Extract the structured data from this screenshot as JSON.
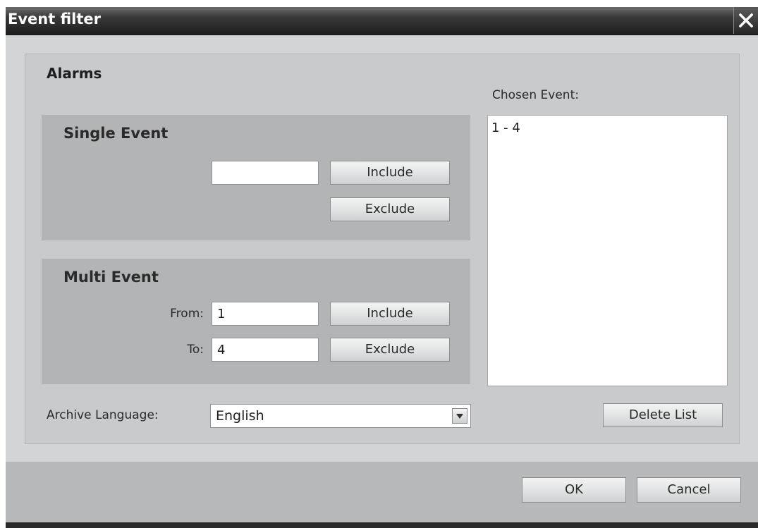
{
  "window": {
    "title": "Event filter"
  },
  "alarms": {
    "title": "Alarms",
    "chosen_label": "Chosen Event:",
    "chosen_items": [
      "1 - 4"
    ],
    "delete_label": "Delete List"
  },
  "single_event": {
    "title": "Single Event",
    "value": "",
    "include_label": "Include",
    "exclude_label": "Exclude"
  },
  "multi_event": {
    "title": "Multi Event",
    "from_label": "From:",
    "from_value": "1",
    "to_label": "To:",
    "to_value": "4",
    "include_label": "Include",
    "exclude_label": "Exclude"
  },
  "archive_language": {
    "label": "Archive Language:",
    "value": "English"
  },
  "footer": {
    "ok_label": "OK",
    "cancel_label": "Cancel"
  }
}
